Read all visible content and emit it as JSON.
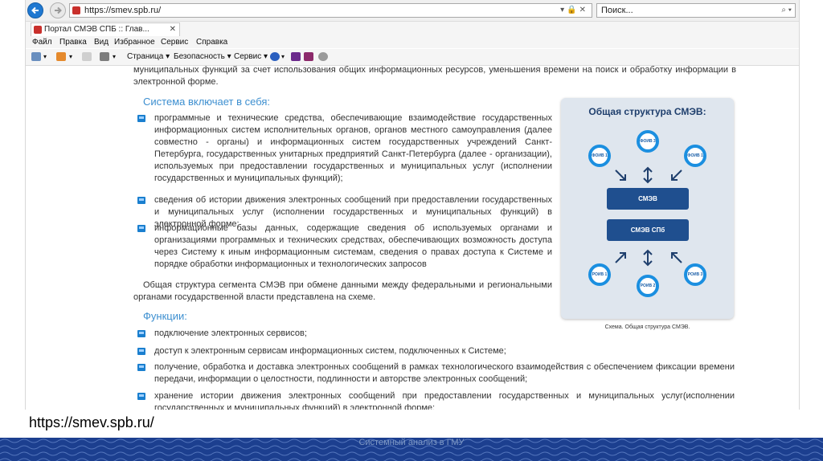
{
  "browser": {
    "address": "https://smev.spb.ru/",
    "search_placeholder": "Поиск...",
    "tab_title": "Портал СМЭВ СПБ :: Глав...",
    "menu": [
      "Файл",
      "Правка",
      "Вид",
      "Избранное",
      "Сервис",
      "Справка"
    ],
    "commands": {
      "page": "Страница ▾",
      "security": "Безопасность ▾",
      "service": "Сервис ▾"
    }
  },
  "content": {
    "intro": "муниципальных функций за счет использования общих информационных ресурсов, уменьшения времени на поиск и обработку информации в электронной форме.",
    "system_heading": "Система включает в себя:",
    "system_items": [
      "программные и технические средства, обеспечивающие взаимодействие государственных информационных систем исполнительных органов, органов местного самоуправления (далее совместно - органы) и информационных систем государственных учреждений Санкт-Петербурга, государственных унитарных предприятий Санкт-Петербурга (далее - организации), используемых при предоставлении государственных и муниципальных услуг (исполнении государственных и муниципальных функций);",
      "сведения об истории движения электронных сообщений при предоставлении государственных и муниципальных услуг (исполнении государственных и муниципальных функций) в электронной форме;",
      "информационные базы данных, содержащие сведения об используемых органами и организациями программных и технических средствах, обеспечивающих возможность доступа через Систему к иным информационным системам, сведения о правах доступа к Системе и порядке обработки информационных и технологических запросов"
    ],
    "structure_text": "Общая структура сегмента СМЭВ при обмене данными между федеральными и региональными органами государственной власти представлена на схеме.",
    "functions_heading": "Функции:",
    "function_items": [
      "подключение электронных сервисов;",
      "доступ к электронным сервисам информационных систем, подключенных к Системе;",
      "получение, обработка и доставка электронных сообщений в рамках технологического взаимодействия с обеспечением фиксации времени передачи, информации о целостности, подлинности и авторстве электронных сообщений;",
      "хранение истории движения электронных сообщений при предоставлении государственных и муниципальных услуг(исполнении государственных и муниципальных функций) в электронной форме;"
    ]
  },
  "scheme": {
    "title": "Общая структура СМЭВ:",
    "top_nodes": [
      "ФОИВ 1",
      "ФОИВ 3",
      "ФОИВ 1"
    ],
    "smev_label": "СМЭВ",
    "smev_spb_label": "СМЭВ СПб",
    "bottom_nodes": [
      "РОИВ 1",
      "РОИВ 2",
      "РОИВ 3"
    ],
    "caption": "Схема. Общая структура СМЭВ."
  },
  "slide": {
    "url_caption": "https://smev.spb.ru/",
    "footer_label": "Системный анализ в ГМУ"
  },
  "colors": {
    "accent": "#3d8fd0",
    "footer": "#1c3f8f",
    "node_ring": "#1b8fe0",
    "box": "#1f4f8f"
  }
}
